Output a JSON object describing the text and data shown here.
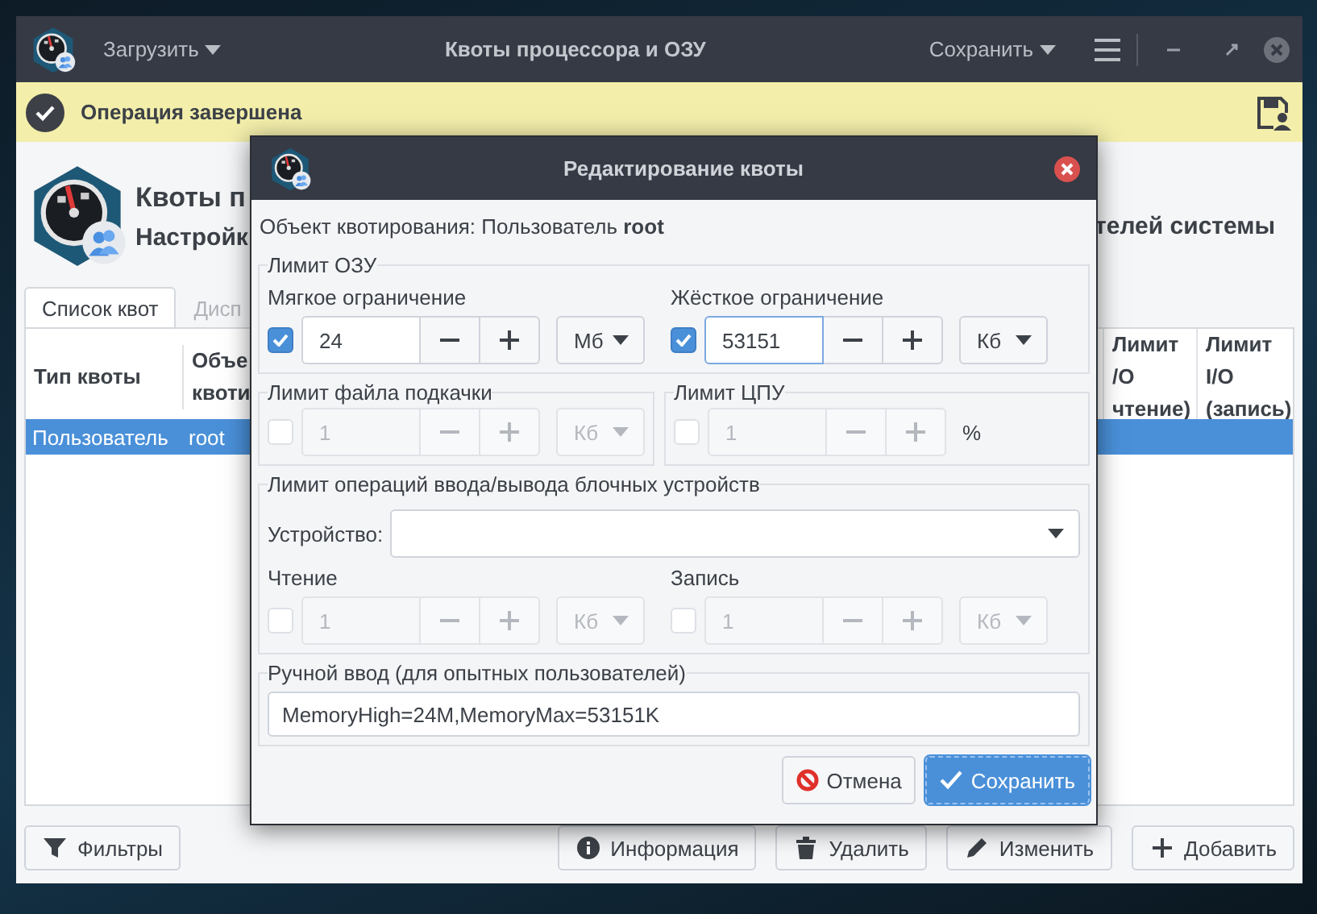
{
  "window": {
    "title": "Квоты процессора и ОЗУ",
    "load_menu": "Загрузить",
    "save_menu": "Сохранить"
  },
  "infobar": {
    "message": "Операция завершена"
  },
  "header": {
    "title": "Квоты п",
    "subtitle": "Настройк",
    "subtitle_right": "телей системы"
  },
  "tabs": [
    {
      "label": "Список квот",
      "selected": true
    },
    {
      "label": "Дисп",
      "selected": false
    }
  ],
  "table": {
    "columns": [
      "Тип квоты",
      "Объе\nквоти",
      "Лимит\n/O\nчтение)",
      "Лимит\nI/O\n(запись)"
    ],
    "rows": [
      {
        "cells": [
          "Пользователь",
          "root"
        ],
        "selected": true
      }
    ]
  },
  "toolbar": [
    {
      "label": "Фильтры",
      "kind": "filter"
    },
    {
      "label": "Информация",
      "kind": "info"
    },
    {
      "label": "Удалить",
      "kind": "delete"
    },
    {
      "label": "Изменить",
      "kind": "edit"
    },
    {
      "label": "Добавить",
      "kind": "add"
    }
  ],
  "dialog": {
    "title": "Редактирование квоты",
    "subject": "Объект квотирования: Пользователь **root**",
    "ram": {
      "legend": "Лимит ОЗУ",
      "limits": [
        {
          "label": "Мягкое ограничение",
          "checked": true,
          "disabled": false,
          "focused": false,
          "value": "24",
          "unit": "Мб"
        },
        {
          "label": "Жёсткое ограничение",
          "checked": true,
          "disabled": false,
          "focused": true,
          "value": "53151",
          "unit": "Кб"
        }
      ]
    },
    "swap": {
      "legend": "Лимит файла подкачки",
      "limit": {
        "checked": false,
        "disabled": true,
        "focused": false,
        "value": "1",
        "unit": "Кб"
      }
    },
    "cpu": {
      "legend": "Лимит ЦПУ",
      "limit": {
        "checked": false,
        "disabled": true,
        "focused": false,
        "value": "1",
        "suffix": "%"
      }
    },
    "io": {
      "legend": "Лимит операций ввода/вывода блочных устройств",
      "device_label": "Устройство:",
      "limits": [
        {
          "label": "Чтение",
          "checked": false,
          "disabled": true,
          "focused": false,
          "value": "1",
          "unit": "Кб"
        },
        {
          "label": "Запись",
          "checked": false,
          "disabled": true,
          "focused": false,
          "value": "1",
          "unit": "Кб"
        }
      ]
    },
    "manual": {
      "legend": "Ручной ввод (для опытных пользователей)",
      "value": "MemoryHigh=24M,MemoryMax=53151K"
    },
    "buttons": [
      {
        "label": "Отмена",
        "kind": "cancel"
      },
      {
        "label": "Сохранить",
        "kind": "ok"
      }
    ]
  }
}
